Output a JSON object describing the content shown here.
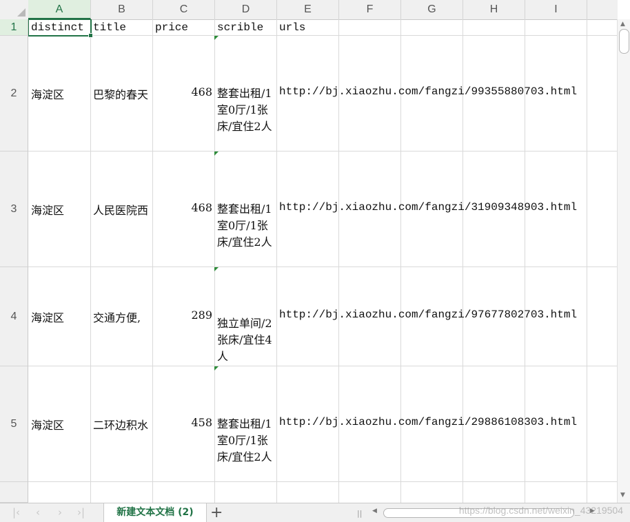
{
  "columns": [
    "A",
    "B",
    "C",
    "D",
    "E",
    "F",
    "G",
    "H",
    "I"
  ],
  "rows": [
    "1",
    "2",
    "3",
    "4",
    "5"
  ],
  "headers": {
    "distinct": "distinct",
    "title": "title",
    "price": "price",
    "scrible": "scrible",
    "urls": "urls"
  },
  "data": [
    {
      "distinct": "海淀区",
      "title": "巴黎的春天",
      "price": "468",
      "scrible": "整套出租/1室0厅/1张床/宜住2人",
      "url": "http://bj.xiaozhu.com/fangzi/99355880703.html"
    },
    {
      "distinct": "海淀区",
      "title": "人民医院西",
      "price": "468",
      "scrible": "整套出租/1室0厅/1张床/宜住2人",
      "url": "http://bj.xiaozhu.com/fangzi/31909348903.html"
    },
    {
      "distinct": "海淀区",
      "title": "交通方便,",
      "price": "289",
      "scrible": "独立单间/2张床/宜住4人",
      "url": "http://bj.xiaozhu.com/fangzi/97677802703.html"
    },
    {
      "distinct": "海淀区",
      "title": "二环边积水",
      "price": "458",
      "scrible": "整套出租/1室0厅/1张床/宜住2人",
      "url": "http://bj.xiaozhu.com/fangzi/29886108303.html"
    }
  ],
  "sheet_tab": "新建文本文档 (2)",
  "add_tab": "+",
  "watermark": "https://blog.csdn.net/weixin_43219504",
  "nav": {
    "first": "|‹",
    "prev": "‹",
    "next": "›",
    "last": "›|"
  },
  "colors": {
    "accent": "#217346"
  }
}
